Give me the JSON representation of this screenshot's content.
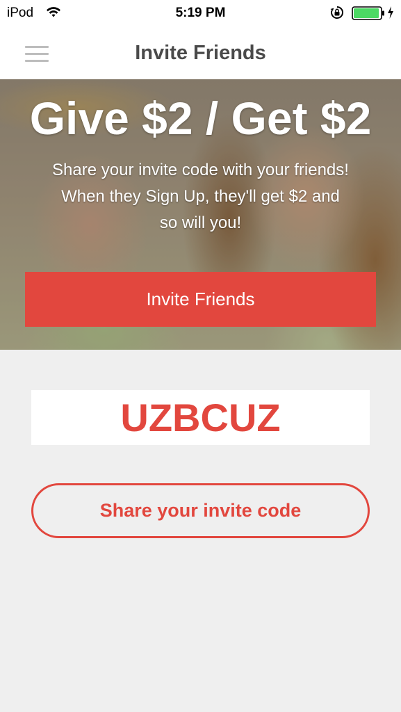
{
  "status_bar": {
    "carrier": "iPod",
    "time": "5:19 PM",
    "battery_level": 0.95,
    "battery_color": "#4cd964"
  },
  "nav": {
    "title": "Invite Friends",
    "menu_icon": "hamburger-menu-icon"
  },
  "hero": {
    "headline": "Give $2 / Get $2",
    "subtext_lines": [
      "Share your invite code with your friends!",
      "When they Sign Up, they'll get $2 and",
      "so will you!"
    ],
    "invite_button_label": "Invite Friends"
  },
  "invite": {
    "code": "UZBCUZ",
    "share_button_label": "Share your invite code"
  },
  "colors": {
    "accent": "#e2473e",
    "background": "#efefef"
  }
}
